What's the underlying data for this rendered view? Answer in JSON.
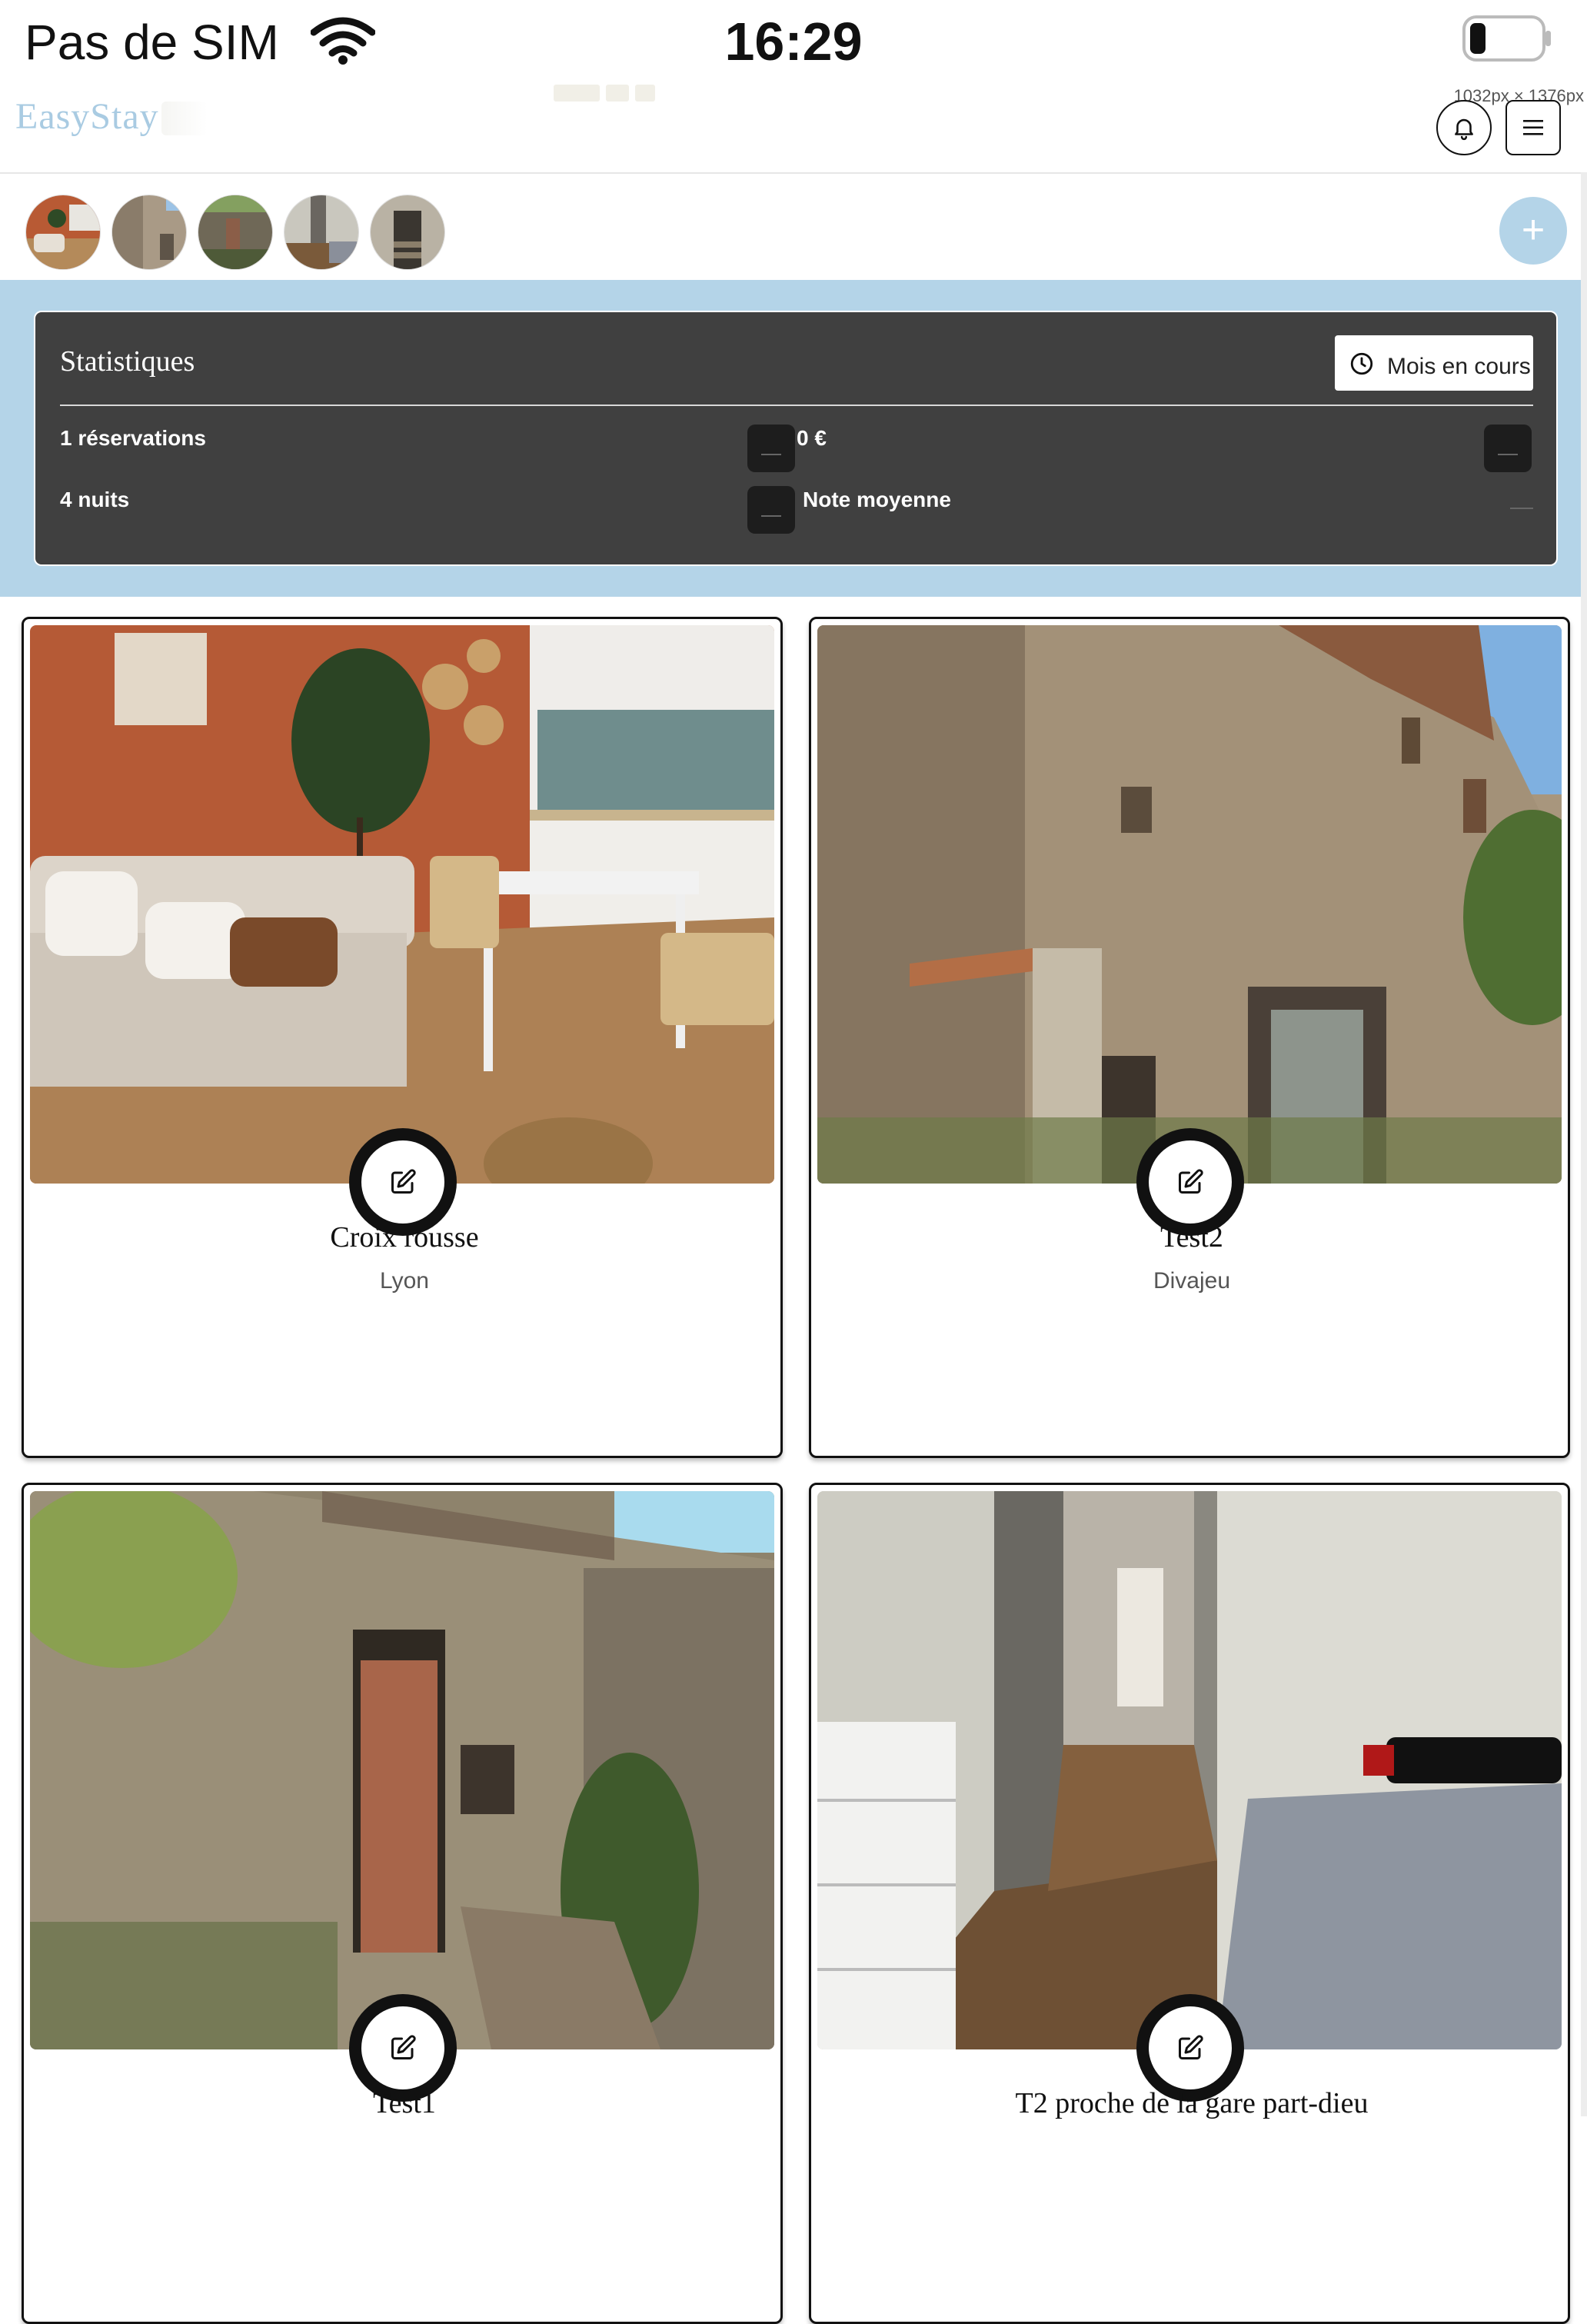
{
  "status_bar": {
    "carrier": "Pas de SIM",
    "time": "16:29"
  },
  "header": {
    "logo": "EasyStay",
    "dimensions_text": "1032px × 1376px"
  },
  "avatars": [
    {
      "name": "avatar-croix-rousse"
    },
    {
      "name": "avatar-test2"
    },
    {
      "name": "avatar-test1"
    },
    {
      "name": "avatar-t2"
    },
    {
      "name": "avatar-stairs"
    }
  ],
  "add_button": {
    "label": "+"
  },
  "stats": {
    "title": "Statistiques",
    "period_label": "Mois en cours",
    "reservations": "1  réservations",
    "revenue": "0  €",
    "nights": "4  nuits",
    "rating_label": "Note moyenne"
  },
  "properties": [
    {
      "name": "Croix rousse",
      "city": "Lyon"
    },
    {
      "name": "Test2",
      "city": "Divajeu"
    },
    {
      "name": "Test1",
      "city": ""
    },
    {
      "name": "T2 proche de la gare part-dieu",
      "city": ""
    }
  ],
  "colors": {
    "accent": "#b4d4e8",
    "stats_card": "#404040",
    "logo": "#a9cbe2"
  }
}
